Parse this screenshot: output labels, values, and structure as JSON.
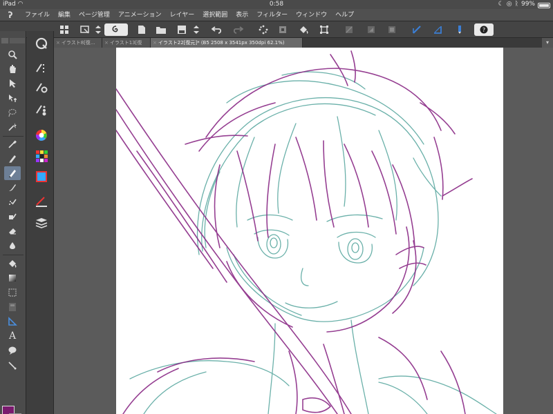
{
  "status": {
    "device": "iPad",
    "time": "0:58",
    "battery": "99%",
    "battery_level": 0.99
  },
  "menu": {
    "items": [
      "ファイル",
      "編集",
      "ページ管理",
      "アニメーション",
      "レイヤー",
      "選択範囲",
      "表示",
      "フィルター",
      "ウィンドウ",
      "ヘルプ"
    ]
  },
  "tabs": [
    {
      "label": "イラスト8[復..."
    },
    {
      "label": "イラスト13[復"
    },
    {
      "label": "イラスト22[復元]* (B5 2508 x 3541px 350dpi 62.1%)"
    }
  ],
  "colors": {
    "main_color": "#7a1a6e",
    "sub_color": "#f1c9a6",
    "sketch_purple": "#8a2a86",
    "sketch_teal": "#5aa8a0",
    "selected_tool": "#6d7f96"
  },
  "tools": {
    "text_tool": "A"
  }
}
